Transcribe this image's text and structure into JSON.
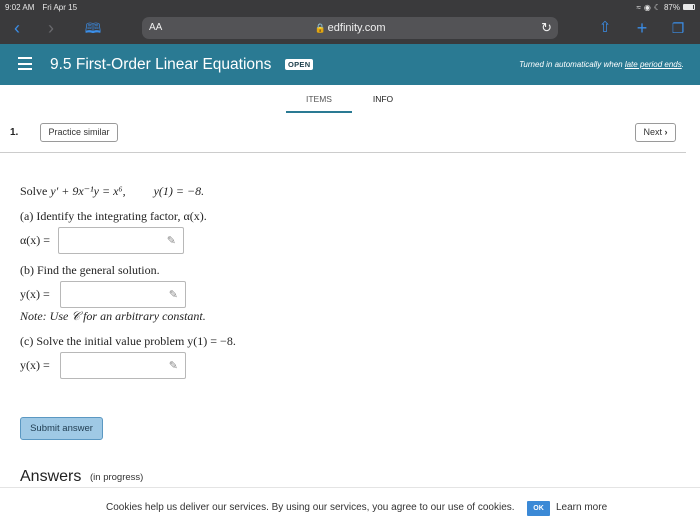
{
  "status_bar": {
    "time": "9:02 AM",
    "date": "Fri Apr 15",
    "battery_text": "87%",
    "battery_level": 0.87
  },
  "browser": {
    "text_size_label": "AA",
    "url": "edfinity.com",
    "icons": {
      "back": "chevron-left-icon",
      "forward": "chevron-right-icon",
      "bookmarks": "book-icon",
      "lock": "lock-icon",
      "reload": "reload-icon",
      "share": "share-icon",
      "new_tab": "plus-icon",
      "tabs": "tabs-icon"
    }
  },
  "header": {
    "title": "9.5 First-Order Linear Equations",
    "badge": "OPEN",
    "turned_in_prefix": "Turned in automatically when ",
    "turned_in_link": "late period ends",
    "turned_in_suffix": "."
  },
  "tabs": [
    {
      "label": "ITEMS",
      "active": true
    },
    {
      "label": "INFO",
      "active": false
    }
  ],
  "question": {
    "number": "1.",
    "practice_label": "Practice similar",
    "next_label": "Next",
    "prompt_solve": "Solve",
    "prompt_equation": "y′ + 9x⁻¹y = x⁶,",
    "prompt_condition": "y(1) = −8.",
    "part_a_label": "(a) Identify the integrating factor, α(x).",
    "part_a_field": "α(x) =",
    "part_b_label": "(b) Find the general solution.",
    "part_b_field": "y(x) =",
    "note": "Note: Use 𝒞 for an arbitrary constant.",
    "part_c_label": "(c) Solve the initial value problem y(1) = −8.",
    "part_c_field": "y(x) ="
  },
  "submit_label": "Submit answer",
  "answers": {
    "heading": "Answers",
    "status": "(in progress)"
  },
  "cookie": {
    "text": "Cookies help us deliver our services. By using our services, you agree to our use of cookies.",
    "ok_label": "OK",
    "learn_more_label": "Learn more"
  },
  "colors": {
    "header_bg": "#2a7a93",
    "browser_bg": "#3a3a3c",
    "link_blue": "#3b8ee8",
    "submit_bg": "#9fc9e5"
  }
}
